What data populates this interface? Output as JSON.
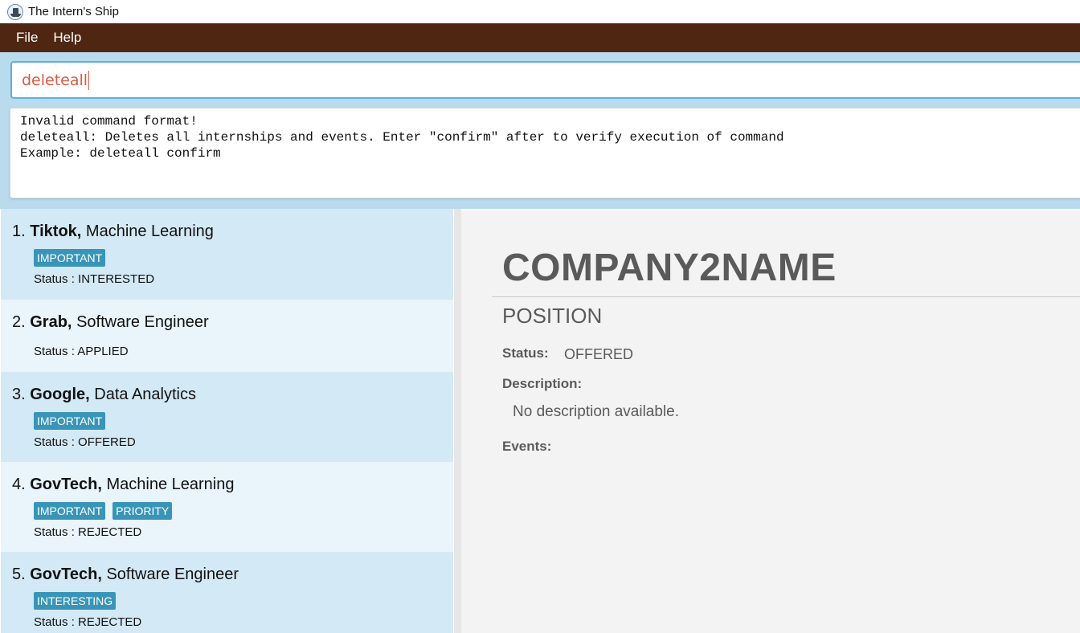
{
  "window": {
    "title": "The Intern's Ship"
  },
  "menu": {
    "file": "File",
    "help": "Help"
  },
  "command": {
    "value": "deleteall"
  },
  "result": {
    "lines": [
      "Invalid command format!",
      "deleteall: Deletes all internships and events. Enter \"confirm\" after to verify execution of command",
      "Example: deleteall confirm"
    ]
  },
  "internships": [
    {
      "index": "1.",
      "company": "Tiktok,",
      "position": "Machine Learning",
      "tags": [
        "IMPORTANT"
      ],
      "status": "Status : INTERESTED"
    },
    {
      "index": "2.",
      "company": "Grab,",
      "position": "Software Engineer",
      "tags": [],
      "status": "Status : APPLIED"
    },
    {
      "index": "3.",
      "company": "Google,",
      "position": "Data Analytics",
      "tags": [
        "IMPORTANT"
      ],
      "status": "Status : OFFERED"
    },
    {
      "index": "4.",
      "company": "GovTech,",
      "position": "Machine Learning",
      "tags": [
        "IMPORTANT",
        "PRIORITY"
      ],
      "status": "Status : REJECTED"
    },
    {
      "index": "5.",
      "company": "GovTech,",
      "position": "Software Engineer",
      "tags": [
        "INTERESTING"
      ],
      "status": "Status : REJECTED"
    }
  ],
  "detail": {
    "company": "COMPANY2NAME",
    "position": "POSITION",
    "status_label": "Status:",
    "status_value": "OFFERED",
    "description_label": "Description:",
    "description_value": "No description available.",
    "events_label": "Events:"
  },
  "colors": {
    "menu_bar": "#4e2611",
    "command_area": "#b9dbed",
    "command_text": "#d95c45",
    "tag": "#3895b8",
    "card_odd": "#d3e9f5",
    "card_even": "#e9f4fb",
    "detail_bg": "#f3f3f3"
  },
  "icons": {
    "app": "ship-icon"
  }
}
